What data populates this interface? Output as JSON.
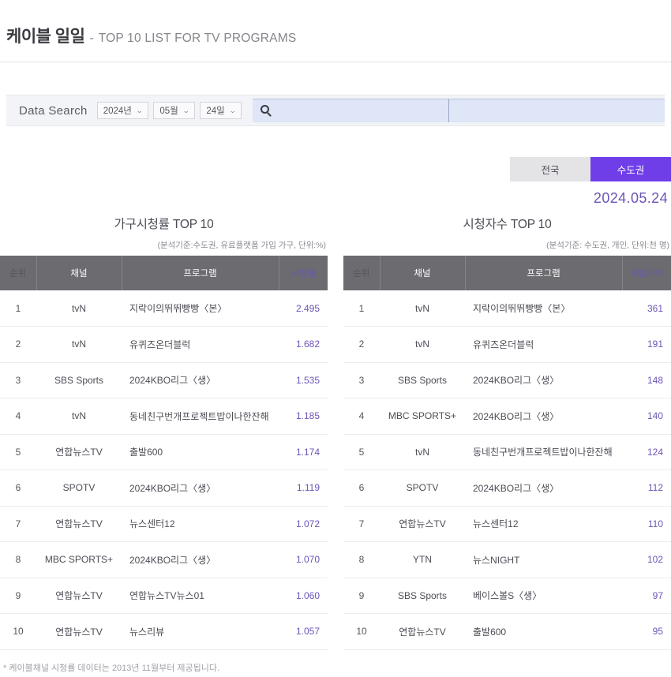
{
  "header": {
    "title_ko": "케이블 일일",
    "dash": "-",
    "title_en": "TOP 10 LIST FOR TV PROGRAMS"
  },
  "search": {
    "label": "Data Search",
    "year": "2024년",
    "month": "05월",
    "day": "24일",
    "chevron": "⌄",
    "input_value": "",
    "input_placeholder": "",
    "search_icon": "search-icon"
  },
  "region_tabs": [
    {
      "label": "전국",
      "active": false
    },
    {
      "label": "수도권",
      "active": true
    }
  ],
  "selected_date": "2024.05.24",
  "accent_purple": "#6f3ee8",
  "value_purple": "#6d55b8",
  "header_gray": "#6b6b70",
  "footnote": "* 케이블채널 시청률 데이터는 2013년 11월부터 제공됩니다.",
  "tables": [
    {
      "title": "가구시청률 TOP 10",
      "subtitle": "(분석기준:수도권, 유료플랫폼 가입 가구, 단위:%)",
      "columns": [
        "순위",
        "채널",
        "프로그램",
        "시청률"
      ],
      "rows": [
        {
          "rank": "1",
          "channel": "tvN",
          "program": "지락이의뛰뛰빵빵〈본〉",
          "value": "2.495"
        },
        {
          "rank": "2",
          "channel": "tvN",
          "program": "유퀴즈온더블럭",
          "value": "1.682"
        },
        {
          "rank": "3",
          "channel": "SBS Sports",
          "program": "2024KBO리그〈생〉",
          "value": "1.535"
        },
        {
          "rank": "4",
          "channel": "tvN",
          "program": "동네친구번개프로젝트밥이나한잔해",
          "value": "1.185"
        },
        {
          "rank": "5",
          "channel": "연합뉴스TV",
          "program": "출발600",
          "value": "1.174"
        },
        {
          "rank": "6",
          "channel": "SPOTV",
          "program": "2024KBO리그〈생〉",
          "value": "1.119"
        },
        {
          "rank": "7",
          "channel": "연합뉴스TV",
          "program": "뉴스센터12",
          "value": "1.072"
        },
        {
          "rank": "8",
          "channel": "MBC SPORTS+",
          "program": "2024KBO리그〈생〉",
          "value": "1.070"
        },
        {
          "rank": "9",
          "channel": "연합뉴스TV",
          "program": "연합뉴스TV뉴스01",
          "value": "1.060"
        },
        {
          "rank": "10",
          "channel": "연합뉴스TV",
          "program": "뉴스리뷰",
          "value": "1.057"
        }
      ]
    },
    {
      "title": "시청자수 TOP 10",
      "subtitle": "(분석기준: 수도권, 개인, 단위:천 명)",
      "columns": [
        "순위",
        "채널",
        "프로그램",
        "시청자수"
      ],
      "rows": [
        {
          "rank": "1",
          "channel": "tvN",
          "program": "지락이의뛰뛰빵빵〈본〉",
          "value": "361"
        },
        {
          "rank": "2",
          "channel": "tvN",
          "program": "유퀴즈온더블럭",
          "value": "191"
        },
        {
          "rank": "3",
          "channel": "SBS Sports",
          "program": "2024KBO리그〈생〉",
          "value": "148"
        },
        {
          "rank": "4",
          "channel": "MBC SPORTS+",
          "program": "2024KBO리그〈생〉",
          "value": "140"
        },
        {
          "rank": "5",
          "channel": "tvN",
          "program": "동네친구번개프로젝트밥이나한잔해",
          "value": "124"
        },
        {
          "rank": "6",
          "channel": "SPOTV",
          "program": "2024KBO리그〈생〉",
          "value": "112"
        },
        {
          "rank": "7",
          "channel": "연합뉴스TV",
          "program": "뉴스센터12",
          "value": "110"
        },
        {
          "rank": "8",
          "channel": "YTN",
          "program": "뉴스NIGHT",
          "value": "102"
        },
        {
          "rank": "9",
          "channel": "SBS Sports",
          "program": "베이스볼S〈생〉",
          "value": "97"
        },
        {
          "rank": "10",
          "channel": "연합뉴스TV",
          "program": "출발600",
          "value": "95"
        }
      ]
    }
  ]
}
